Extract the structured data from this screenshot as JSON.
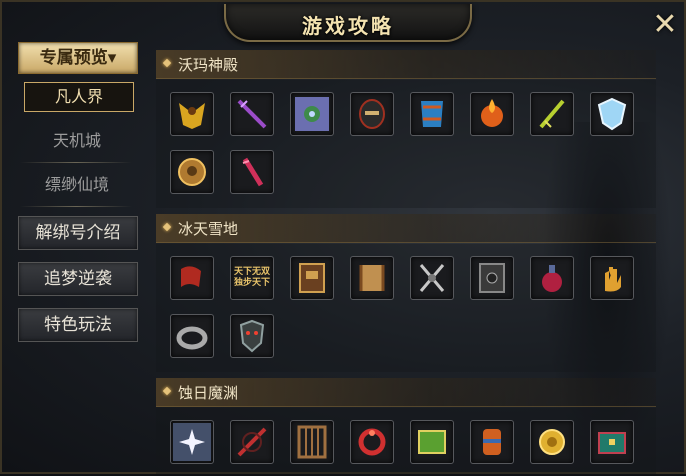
{
  "title": "游戏攻略",
  "close_glyph": "✕",
  "sidebar": {
    "dropdown_label": "专属预览",
    "dropdown_arrow": "▾",
    "sub_active": "凡人界",
    "plain_items": [
      "天机城",
      "缥缈仙境"
    ],
    "buttons": [
      "解绑号介绍",
      "追梦逆袭",
      "特色玩法"
    ]
  },
  "sections": [
    {
      "title": "沃玛神殿",
      "items": [
        "golden-winged-armor-icon",
        "purple-sword-icon",
        "flower-box-icon",
        "dark-helmet-icon",
        "blue-armor-icon",
        "flame-orb-icon",
        "green-blade-icon",
        "ice-shield-icon",
        "bronze-medal-icon",
        "crimson-blade-icon"
      ]
    },
    {
      "title": "冰天雪地",
      "items": [
        "red-flag-icon",
        "golden-text-icon",
        "brown-book-icon",
        "scroll-icon",
        "double-axe-icon",
        "dark-tome-icon",
        "potion-bottle-icon",
        "golden-hand-icon",
        "silver-ring-icon",
        "demon-mask-icon"
      ]
    },
    {
      "title": "蚀日魔渊",
      "items": [
        "white-flower-icon",
        "red-sword-icon",
        "wooden-cage-icon",
        "red-ring-icon",
        "green-book-icon",
        "fire-bracer-icon",
        "gold-coin-icon",
        "teal-chest-icon"
      ]
    }
  ],
  "golden_text": "天下无双 独步天下",
  "colors": {
    "gold": "#e5c27a",
    "title": "#f4e3b0"
  }
}
